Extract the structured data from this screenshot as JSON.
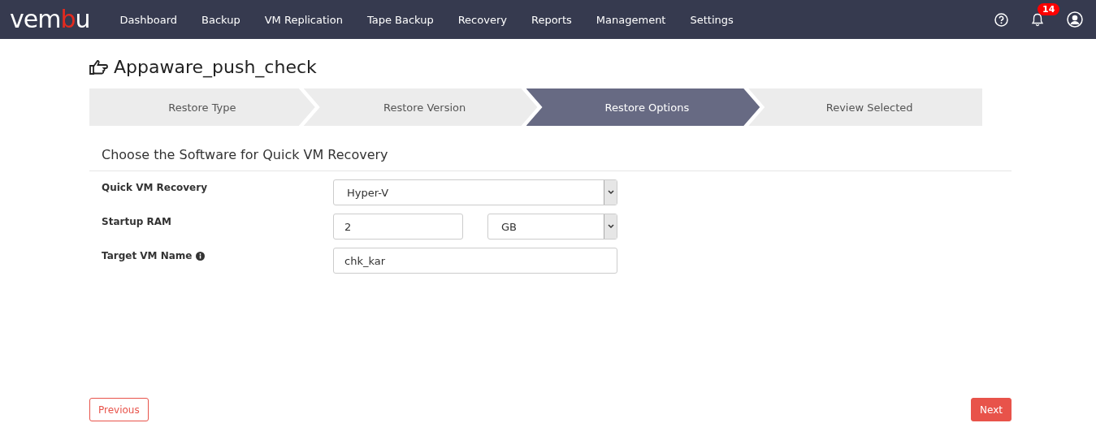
{
  "nav": {
    "logo": {
      "start": "vem",
      "accent": "b",
      "end": "u"
    },
    "items": [
      {
        "label": "Dashboard",
        "selected": false
      },
      {
        "label": "Backup",
        "selected": false
      },
      {
        "label": "VM Replication",
        "selected": false
      },
      {
        "label": "Tape Backup",
        "selected": false
      },
      {
        "label": "Recovery",
        "selected": false
      },
      {
        "label": "Reports",
        "selected": false
      },
      {
        "label": "Management",
        "selected": false
      },
      {
        "label": "Settings",
        "selected": false
      }
    ],
    "notifications_badge": "14"
  },
  "title": "Appaware_push_check",
  "steps": [
    {
      "label": "Restore Type",
      "selected": false
    },
    {
      "label": "Restore Version",
      "selected": false
    },
    {
      "label": "Restore Options",
      "selected": true
    },
    {
      "label": "Review Selected",
      "selected": false
    }
  ],
  "section_title": "Choose the Software for Quick VM Recovery",
  "fields": [
    {
      "kind": "select",
      "label": "Quick VM Recovery",
      "value": "Hyper-V"
    },
    {
      "kind": "input-select",
      "label": "Startup RAM",
      "value": "2",
      "unit": "GB"
    },
    {
      "kind": "input",
      "label": "Target VM Name",
      "value": "chk_kar",
      "info": true
    }
  ],
  "buttons": {
    "previous": "Previous",
    "next": "Next"
  }
}
